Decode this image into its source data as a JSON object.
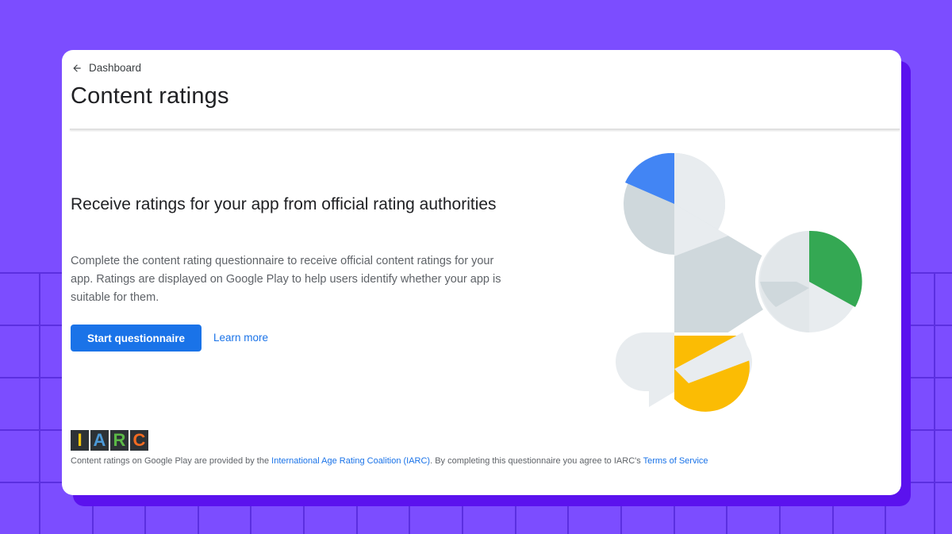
{
  "nav": {
    "back_label": "Dashboard"
  },
  "page": {
    "title": "Content ratings"
  },
  "main": {
    "headline": "Receive ratings for your app from official rating authorities",
    "description": "Complete the content rating questionnaire to receive official content ratings for your app. Ratings are displayed on Google Play to help users identify whether your app is suitable for them.",
    "primary_button": "Start questionnaire",
    "secondary_link": "Learn more"
  },
  "iarc": {
    "letters": [
      {
        "char": "I",
        "color": "#f9c80e"
      },
      {
        "char": "A",
        "color": "#4c9ad8"
      },
      {
        "char": "R",
        "color": "#5bb947"
      },
      {
        "char": "C",
        "color": "#f26b22"
      }
    ],
    "footer_prefix": "Content ratings on Google Play are provided by the ",
    "footer_link_iarc": "International Age Rating Coalition (IARC)",
    "footer_middle": ". By completing this questionnaire you agree to IARC's ",
    "footer_link_terms": "Terms of Service"
  },
  "colors": {
    "background": "#7c4dff",
    "accent": "#1a73e8",
    "blue_slice": "#4285f4",
    "green_slice": "#34a853",
    "yellow_slice": "#fbbc04"
  }
}
